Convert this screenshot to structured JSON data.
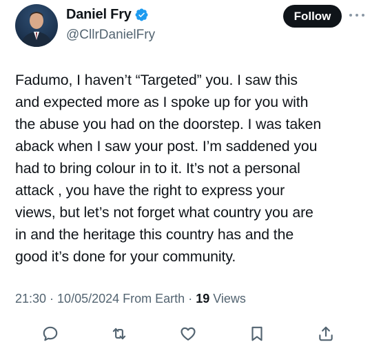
{
  "author": {
    "display_name": "Daniel Fry",
    "handle": "@CllrDanielFry",
    "verified": true,
    "verified_color": "#1d9bf0",
    "avatar_icon": "profile-photo"
  },
  "follow_label": "Follow",
  "more_icon": "more-horizontal-icon",
  "tweet": {
    "text": "Fadumo, I haven’t “Targeted” you. I saw this\nand expected more as I spoke up for you with\nthe abuse you had on the doorstep. I was taken\naback when I saw your post. I’m saddened you\nhad to bring colour in to it. It’s not a personal\nattack , you have the right to express your\nviews, but let’s not forget what country you are\nin and the heritage this country has and the\ngood it’s done for your community."
  },
  "meta": {
    "time": "21:30",
    "separator": " · ",
    "date": "10/05/2024",
    "source": "From Earth",
    "views_count": "19",
    "views_label": "Views"
  },
  "actions": [
    "reply-icon",
    "retweet-icon",
    "like-icon",
    "bookmark-icon",
    "share-icon"
  ],
  "colors": {
    "text": "#0f1419",
    "secondary": "#536471",
    "follow_bg": "#0f1419"
  }
}
